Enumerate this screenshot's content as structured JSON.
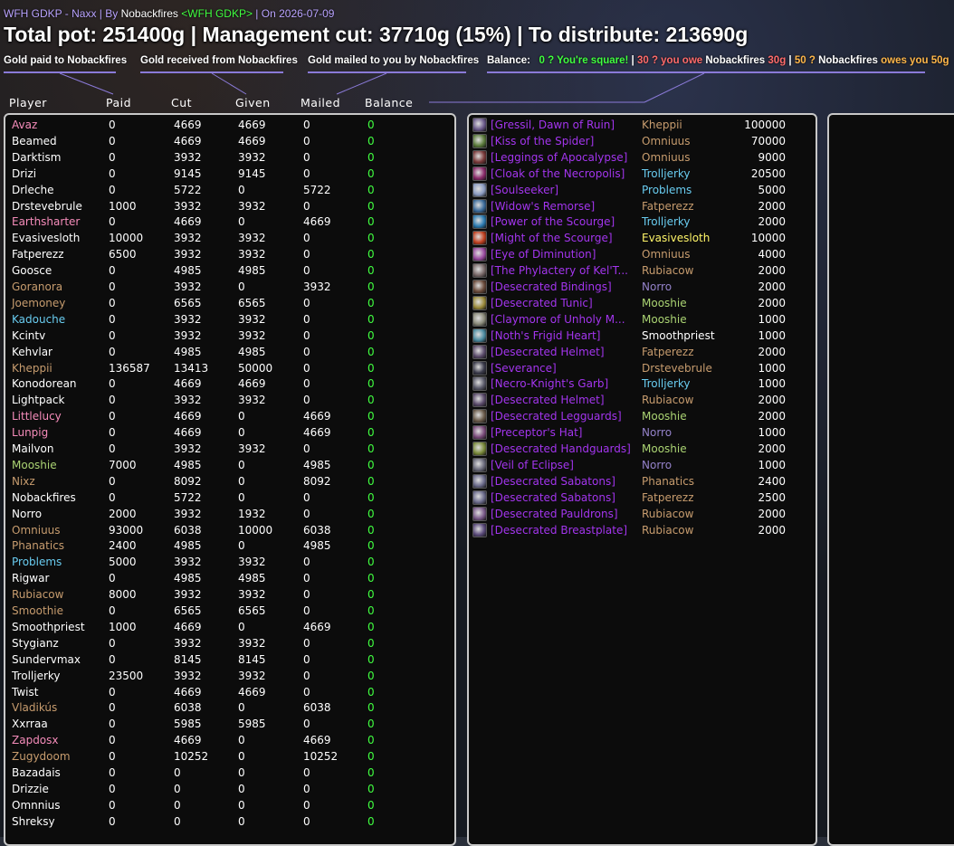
{
  "header": {
    "prefix": "WFH GDKP - Naxx | By ",
    "author": "Nobackfires",
    "guild": "<WFH GDKP>",
    "date_text": " | On 2026-07-09"
  },
  "title": "Total pot: 251400g | Management cut: 37710g (15%) | To distribute: 213690g",
  "legend": {
    "paid": "Gold paid to Nobackfires",
    "received": "Gold received from Nobackfires",
    "mailed": "Gold mailed to you by Nobackfires",
    "balance_label": "Balance:",
    "balance_square": "0 ? You're square!",
    "sep1": " | ",
    "balance_owe": "30 ? you owe ",
    "owe_name": "Nobackfires",
    "owe_amount": " 30g",
    "sep2": " | ",
    "balance_owed_num": "50 ? ",
    "owed_name": "Nobackfires",
    "owed_text": " owes you 50g"
  },
  "columns": [
    "Player",
    "Paid",
    "Cut",
    "Given",
    "Mailed",
    "Balance"
  ],
  "colors": {
    "rogue": "#fff569",
    "priest": "#ffffff",
    "warrior": "#c79c6e",
    "paladin": "#f58cba",
    "mage": "#69ccf0",
    "druid": "#ff7d0a",
    "hunter": "#abd473",
    "warlock": "#9482c9",
    "balance": "#40ff40",
    "epic": "#a335ee"
  },
  "players": [
    {
      "name": "Avaz",
      "color": "#f58cba",
      "paid": "0",
      "cut": "4669",
      "given": "4669",
      "mailed": "0",
      "balance": "0"
    },
    {
      "name": "Beamed",
      "color": "#ffffff",
      "paid": "0",
      "cut": "4669",
      "given": "4669",
      "mailed": "0",
      "balance": "0"
    },
    {
      "name": "Darktism",
      "color": "#ffffff",
      "paid": "0",
      "cut": "3932",
      "given": "3932",
      "mailed": "0",
      "balance": "0"
    },
    {
      "name": "Drizi",
      "color": "#ffffff",
      "paid": "0",
      "cut": "9145",
      "given": "9145",
      "mailed": "0",
      "balance": "0"
    },
    {
      "name": "Drleche",
      "color": "#ffffff",
      "paid": "0",
      "cut": "5722",
      "given": "0",
      "mailed": "5722",
      "balance": "0"
    },
    {
      "name": "Drstevebrule",
      "color": "#ffffff",
      "paid": "1000",
      "cut": "3932",
      "given": "3932",
      "mailed": "0",
      "balance": "0"
    },
    {
      "name": "Earthsharter",
      "color": "#f58cba",
      "paid": "0",
      "cut": "4669",
      "given": "0",
      "mailed": "4669",
      "balance": "0"
    },
    {
      "name": "Evasivesloth",
      "color": "#ffffff",
      "paid": "10000",
      "cut": "3932",
      "given": "3932",
      "mailed": "0",
      "balance": "0"
    },
    {
      "name": "Fatperezz",
      "color": "#ffffff",
      "paid": "6500",
      "cut": "3932",
      "given": "3932",
      "mailed": "0",
      "balance": "0"
    },
    {
      "name": "Goosce",
      "color": "#ffffff",
      "paid": "0",
      "cut": "4985",
      "given": "4985",
      "mailed": "0",
      "balance": "0"
    },
    {
      "name": "Goranora",
      "color": "#c79c6e",
      "paid": "0",
      "cut": "3932",
      "given": "0",
      "mailed": "3932",
      "balance": "0"
    },
    {
      "name": "Joemoney",
      "color": "#c79c6e",
      "paid": "0",
      "cut": "6565",
      "given": "6565",
      "mailed": "0",
      "balance": "0"
    },
    {
      "name": "Kadouche",
      "color": "#69ccf0",
      "paid": "0",
      "cut": "3932",
      "given": "3932",
      "mailed": "0",
      "balance": "0"
    },
    {
      "name": "Kcintv",
      "color": "#ffffff",
      "paid": "0",
      "cut": "3932",
      "given": "3932",
      "mailed": "0",
      "balance": "0"
    },
    {
      "name": "Kehvlar",
      "color": "#ffffff",
      "paid": "0",
      "cut": "4985",
      "given": "4985",
      "mailed": "0",
      "balance": "0"
    },
    {
      "name": "Kheppii",
      "color": "#c79c6e",
      "paid": "136587",
      "cut": "13413",
      "given": "50000",
      "mailed": "0",
      "balance": "0"
    },
    {
      "name": "Konodorean",
      "color": "#ffffff",
      "paid": "0",
      "cut": "4669",
      "given": "4669",
      "mailed": "0",
      "balance": "0"
    },
    {
      "name": "Lightpack",
      "color": "#ffffff",
      "paid": "0",
      "cut": "3932",
      "given": "3932",
      "mailed": "0",
      "balance": "0"
    },
    {
      "name": "Littlelucy",
      "color": "#f58cba",
      "paid": "0",
      "cut": "4669",
      "given": "0",
      "mailed": "4669",
      "balance": "0"
    },
    {
      "name": "Lunpig",
      "color": "#f58cba",
      "paid": "0",
      "cut": "4669",
      "given": "0",
      "mailed": "4669",
      "balance": "0"
    },
    {
      "name": "Mailvon",
      "color": "#ffffff",
      "paid": "0",
      "cut": "3932",
      "given": "3932",
      "mailed": "0",
      "balance": "0"
    },
    {
      "name": "Mooshie",
      "color": "#abd473",
      "paid": "7000",
      "cut": "4985",
      "given": "0",
      "mailed": "4985",
      "balance": "0"
    },
    {
      "name": "Nixz",
      "color": "#c79c6e",
      "paid": "0",
      "cut": "8092",
      "given": "0",
      "mailed": "8092",
      "balance": "0"
    },
    {
      "name": "Nobackfires",
      "color": "#ffffff",
      "paid": "0",
      "cut": "5722",
      "given": "0",
      "mailed": "0",
      "balance": "0"
    },
    {
      "name": "Norro",
      "color": "#ffffff",
      "paid": "2000",
      "cut": "3932",
      "given": "1932",
      "mailed": "0",
      "balance": "0"
    },
    {
      "name": "Omniuus",
      "color": "#c79c6e",
      "paid": "93000",
      "cut": "6038",
      "given": "10000",
      "mailed": "6038",
      "balance": "0"
    },
    {
      "name": "Phanatics",
      "color": "#c79c6e",
      "paid": "2400",
      "cut": "4985",
      "given": "0",
      "mailed": "4985",
      "balance": "0"
    },
    {
      "name": "Problems",
      "color": "#69ccf0",
      "paid": "5000",
      "cut": "3932",
      "given": "3932",
      "mailed": "0",
      "balance": "0"
    },
    {
      "name": "Rigwar",
      "color": "#ffffff",
      "paid": "0",
      "cut": "4985",
      "given": "4985",
      "mailed": "0",
      "balance": "0"
    },
    {
      "name": "Rubiacow",
      "color": "#c79c6e",
      "paid": "8000",
      "cut": "3932",
      "given": "3932",
      "mailed": "0",
      "balance": "0"
    },
    {
      "name": "Smoothie",
      "color": "#c79c6e",
      "paid": "0",
      "cut": "6565",
      "given": "6565",
      "mailed": "0",
      "balance": "0"
    },
    {
      "name": "Smoothpriest",
      "color": "#ffffff",
      "paid": "1000",
      "cut": "4669",
      "given": "0",
      "mailed": "4669",
      "balance": "0"
    },
    {
      "name": "Stygianz",
      "color": "#ffffff",
      "paid": "0",
      "cut": "3932",
      "given": "3932",
      "mailed": "0",
      "balance": "0"
    },
    {
      "name": "Sundervmax",
      "color": "#ffffff",
      "paid": "0",
      "cut": "8145",
      "given": "8145",
      "mailed": "0",
      "balance": "0"
    },
    {
      "name": "Trolljerky",
      "color": "#ffffff",
      "paid": "23500",
      "cut": "3932",
      "given": "3932",
      "mailed": "0",
      "balance": "0"
    },
    {
      "name": "Twist",
      "color": "#ffffff",
      "paid": "0",
      "cut": "4669",
      "given": "4669",
      "mailed": "0",
      "balance": "0"
    },
    {
      "name": "Vladikús",
      "color": "#c79c6e",
      "paid": "0",
      "cut": "6038",
      "given": "0",
      "mailed": "6038",
      "balance": "0"
    },
    {
      "name": "Xxrraa",
      "color": "#ffffff",
      "paid": "0",
      "cut": "5985",
      "given": "5985",
      "mailed": "0",
      "balance": "0"
    },
    {
      "name": "Zapdosx",
      "color": "#f58cba",
      "paid": "0",
      "cut": "4669",
      "given": "0",
      "mailed": "4669",
      "balance": "0"
    },
    {
      "name": "Zugydoom",
      "color": "#c79c6e",
      "paid": "0",
      "cut": "10252",
      "given": "0",
      "mailed": "10252",
      "balance": "0"
    },
    {
      "name": "Bazadais",
      "color": "#ffffff",
      "paid": "0",
      "cut": "0",
      "given": "0",
      "mailed": "0",
      "balance": "0"
    },
    {
      "name": "Drizzie",
      "color": "#ffffff",
      "paid": "0",
      "cut": "0",
      "given": "0",
      "mailed": "0",
      "balance": "0"
    },
    {
      "name": "Omnnius",
      "color": "#ffffff",
      "paid": "0",
      "cut": "0",
      "given": "0",
      "mailed": "0",
      "balance": "0"
    },
    {
      "name": "Shreksy",
      "color": "#ffffff",
      "paid": "0",
      "cut": "0",
      "given": "0",
      "mailed": "0",
      "balance": "0"
    }
  ],
  "items": [
    {
      "name": "[Gressil, Dawn of Ruin]",
      "buyer": "Kheppii",
      "buyer_color": "#c79c6e",
      "price": "100000",
      "icon": "#6b5a8a"
    },
    {
      "name": "[Kiss of the Spider]",
      "buyer": "Omniuus",
      "buyer_color": "#c79c6e",
      "price": "70000",
      "icon": "#5a7a3a"
    },
    {
      "name": "[Leggings of Apocalypse]",
      "buyer": "Omniuus",
      "buyer_color": "#c79c6e",
      "price": "9000",
      "icon": "#7a3a3a"
    },
    {
      "name": "[Cloak of the Necropolis]",
      "buyer": "Trolljerky",
      "buyer_color": "#69ccf0",
      "price": "20500",
      "icon": "#8a2a6a"
    },
    {
      "name": "[Soulseeker]",
      "buyer": "Problems",
      "buyer_color": "#69ccf0",
      "price": "5000",
      "icon": "#8a9ac0"
    },
    {
      "name": "[Widow's Remorse]",
      "buyer": "Fatperezz",
      "buyer_color": "#c79c6e",
      "price": "2000",
      "icon": "#3a6a9a"
    },
    {
      "name": "[Power of the Scourge]",
      "buyer": "Trolljerky",
      "buyer_color": "#69ccf0",
      "price": "2000",
      "icon": "#2a7ab0"
    },
    {
      "name": "[Might of the Scourge]",
      "buyer": "Evasivesloth",
      "buyer_color": "#fff569",
      "price": "10000",
      "icon": "#c04020"
    },
    {
      "name": "[Eye of Diminution]",
      "buyer": "Omniuus",
      "buyer_color": "#c79c6e",
      "price": "4000",
      "icon": "#9a4aa0"
    },
    {
      "name": "[The Phylactery of Kel'T...",
      "buyer": "Rubiacow",
      "buyer_color": "#c79c6e",
      "price": "2000",
      "icon": "#7a6a6a"
    },
    {
      "name": "[Desecrated Bindings]",
      "buyer": "Norro",
      "buyer_color": "#9482c9",
      "price": "2000",
      "icon": "#6a4a3a"
    },
    {
      "name": "[Desecrated Tunic]",
      "buyer": "Mooshie",
      "buyer_color": "#abd473",
      "price": "2000",
      "icon": "#9a8a3a"
    },
    {
      "name": "[Claymore of Unholy M...",
      "buyer": "Mooshie",
      "buyer_color": "#abd473",
      "price": "1000",
      "icon": "#8a8a7a"
    },
    {
      "name": "[Noth's Frigid Heart]",
      "buyer": "Smoothpriest",
      "buyer_color": "#ffffff",
      "price": "1000",
      "icon": "#4a8aa0"
    },
    {
      "name": "[Desecrated Helmet]",
      "buyer": "Fatperezz",
      "buyer_color": "#c79c6e",
      "price": "2000",
      "icon": "#5a4a6a"
    },
    {
      "name": "[Severance]",
      "buyer": "Drstevebrule",
      "buyer_color": "#c79c6e",
      "price": "1000",
      "icon": "#3a3a4a"
    },
    {
      "name": "[Necro-Knight's Garb]",
      "buyer": "Trolljerky",
      "buyer_color": "#69ccf0",
      "price": "1000",
      "icon": "#5a5a6a"
    },
    {
      "name": "[Desecrated Helmet]",
      "buyer": "Rubiacow",
      "buyer_color": "#c79c6e",
      "price": "2000",
      "icon": "#5a4a6a"
    },
    {
      "name": "[Desecrated Legguards]",
      "buyer": "Mooshie",
      "buyer_color": "#abd473",
      "price": "2000",
      "icon": "#6a5a4a"
    },
    {
      "name": "[Preceptor's Hat]",
      "buyer": "Norro",
      "buyer_color": "#9482c9",
      "price": "1000",
      "icon": "#7a4a7a"
    },
    {
      "name": "[Desecrated Handguards]",
      "buyer": "Mooshie",
      "buyer_color": "#abd473",
      "price": "2000",
      "icon": "#7a8a3a"
    },
    {
      "name": "[Veil of Eclipse]",
      "buyer": "Norro",
      "buyer_color": "#9482c9",
      "price": "1000",
      "icon": "#6a6a7a"
    },
    {
      "name": "[Desecrated Sabatons]",
      "buyer": "Phanatics",
      "buyer_color": "#c79c6e",
      "price": "2400",
      "icon": "#6a6a8a"
    },
    {
      "name": "[Desecrated Sabatons]",
      "buyer": "Fatperezz",
      "buyer_color": "#c79c6e",
      "price": "2500",
      "icon": "#6a6a8a"
    },
    {
      "name": "[Desecrated Pauldrons]",
      "buyer": "Rubiacow",
      "buyer_color": "#c79c6e",
      "price": "2000",
      "icon": "#7a5a8a"
    },
    {
      "name": "[Desecrated Breastplate]",
      "buyer": "Rubiacow",
      "buyer_color": "#c79c6e",
      "price": "2000",
      "icon": "#5a4a7a"
    }
  ]
}
